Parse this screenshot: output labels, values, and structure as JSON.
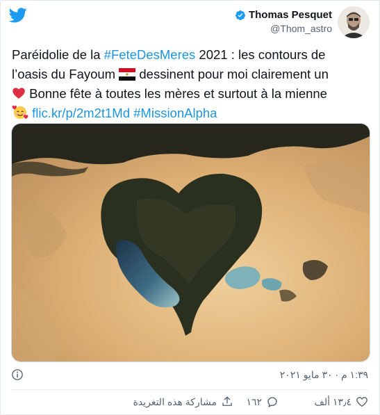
{
  "author": {
    "name": "Thomas Pesquet",
    "handle": "@Thom_astro",
    "verified": true
  },
  "tweet": {
    "line1_prefix": "Paréidolie de la ",
    "hashtag1": "#FeteDesMeres",
    "line1_suffix": " 2021 : les contours de",
    "line2_prefix": "l’oasis du Fayoum ",
    "line2_suffix": " dessinent pour moi clairement un",
    "line3": " Bonne fête à toutes les mères et surtout à la mienne",
    "link": "flic.kr/p/2m2t1Md",
    "hashtag2": "#MissionAlpha",
    "emojis": [
      "egypt-flag",
      "red-heart",
      "smiling-face-with-hearts"
    ]
  },
  "meta": {
    "timestamp": "١:٣٩ م · ٣٠ مايو ٢٠٢١"
  },
  "actions": {
    "likes": "١٣٫٤ ألف",
    "replies": "١٦٢",
    "share_label": "مشاركة هذه التغريدة"
  },
  "colors": {
    "twitter_blue": "#1d9bf0",
    "link_blue": "#1b95e0",
    "text": "#0f1419",
    "secondary": "#536471",
    "border": "#e1e8ed"
  }
}
